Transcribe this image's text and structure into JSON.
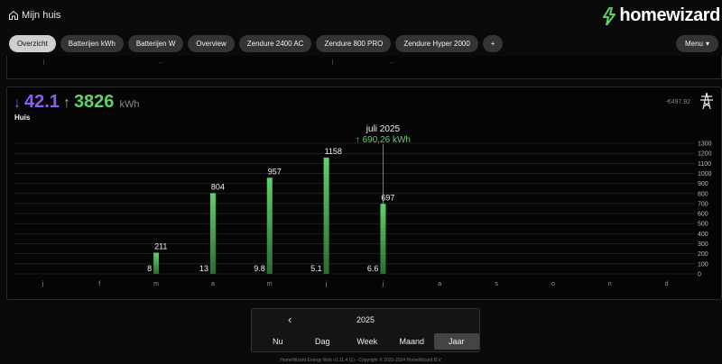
{
  "header": {
    "home_label": "Mijn huis",
    "brand": "homewizard"
  },
  "tabs": [
    {
      "label": "Overzicht",
      "active": true
    },
    {
      "label": "Batterijen kWh",
      "active": false
    },
    {
      "label": "Batterijen W",
      "active": false
    },
    {
      "label": "Overview",
      "active": false
    },
    {
      "label": "Zendure 2400 AC",
      "active": false
    },
    {
      "label": "Zendure 800 PRO",
      "active": false
    },
    {
      "label": "Zendure Hyper 2000",
      "active": false
    },
    {
      "label": "+",
      "active": false
    }
  ],
  "menu_label": "Menu",
  "prev_chart_ticks": [
    "j",
    "",
    "...",
    "",
    "",
    "j",
    "...",
    "",
    ""
  ],
  "card": {
    "import_value": "42.1",
    "export_value": "3826",
    "unit": "kWh",
    "label": "Huis",
    "cost": "-€497.92",
    "import_color": "#8b5cf6",
    "export_color": "#5fd16a"
  },
  "tooltip": {
    "title": "juli 2025",
    "value": "↑ 690,26 kWh"
  },
  "chart_data": {
    "type": "bar",
    "categories": [
      "j",
      "f",
      "m",
      "a",
      "m",
      "j",
      "j",
      "a",
      "s",
      "o",
      "n",
      "d"
    ],
    "series": [
      {
        "values": [
          null,
          null,
          8,
          13,
          9.8,
          5.1,
          6.6,
          null,
          null,
          null,
          null,
          null
        ],
        "labels": [
          null,
          null,
          "8",
          "13",
          "9.8",
          "5.1",
          "6.6",
          null,
          null,
          null,
          null,
          null
        ]
      },
      {
        "values": [
          null,
          null,
          211,
          804,
          957,
          1158,
          697,
          null,
          null,
          null,
          null,
          null
        ],
        "labels": [
          null,
          null,
          "211",
          "804",
          "957",
          "1158",
          "697",
          null,
          null,
          null,
          null,
          null
        ],
        "color": "#5fd16a"
      }
    ],
    "ylim": [
      0,
      1300
    ],
    "yticks": [
      "0",
      "100",
      "200",
      "300",
      "400",
      "500",
      "600",
      "700",
      "800",
      "900",
      "1000",
      "1100",
      "1200",
      "1300"
    ],
    "grid": true,
    "highlight_index": 6
  },
  "period": {
    "year": "2025",
    "buttons": [
      {
        "label": "Nu",
        "active": false
      },
      {
        "label": "Dag",
        "active": false
      },
      {
        "label": "Week",
        "active": false
      },
      {
        "label": "Maand",
        "active": false
      },
      {
        "label": "Jaar",
        "active": true
      }
    ]
  },
  "footer": "HomeWizard Energy Web v1.11.4 (1) - Copyright © 2021-2024 HomeWizard B.V."
}
